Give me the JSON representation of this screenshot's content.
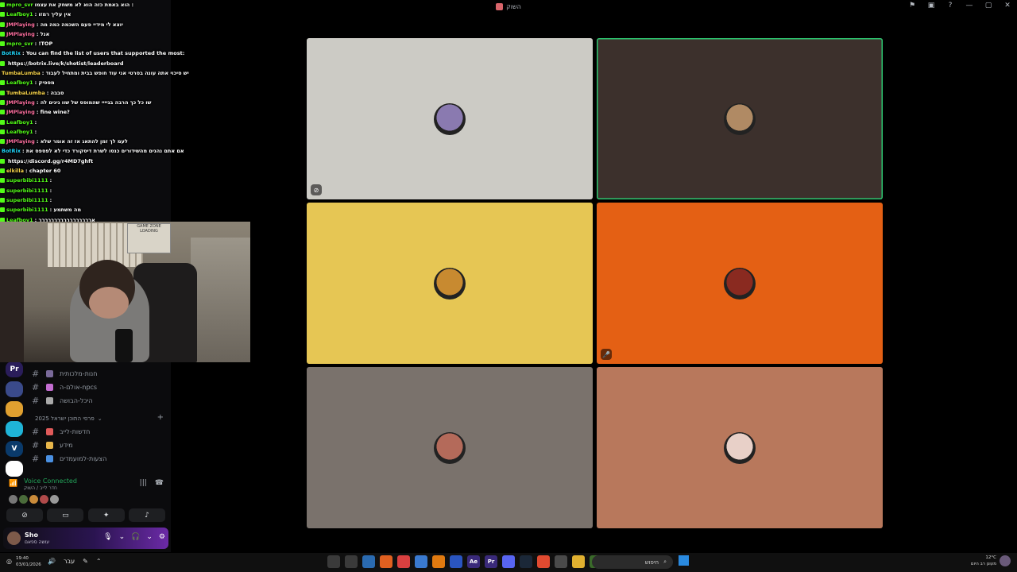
{
  "window": {
    "title": "השוק",
    "controls": [
      "⚑",
      "▣",
      "?",
      "—",
      "▢",
      "✕"
    ]
  },
  "chat": [
    {
      "name": "mpro_svr",
      "text": "הוא באמת כזה הוא לא משחק את עצמו :",
      "color": "green"
    },
    {
      "name": "Leafboy1",
      "text": ": אין עליך רמזו",
      "color": "green"
    },
    {
      "name": "JMPlaying",
      "text": ": יוצא לי מידיי פעם השכמה כמה מה",
      "color": "pink"
    },
    {
      "name": "JMPlaying",
      "text": ": אנל",
      "color": "pink"
    },
    {
      "name": "mpro_svr",
      "text": ": !TOP",
      "color": "green"
    },
    {
      "name": "BotRix",
      "text": ": You can find the list of users that supported the most:",
      "color": "bot"
    },
    {
      "name": "",
      "text": "https://botrix.live/k/shotist/leaderboard",
      "color": "bot"
    },
    {
      "name": "TumbaLumba",
      "text": ": יש סיכוי אתה עונה בסרטי אני עוד חופש בבית ומתחיל לעבוד",
      "color": "yellow"
    },
    {
      "name": "Leafboy1",
      "text": ": מספיק",
      "color": "green"
    },
    {
      "name": "TumbaLumba",
      "text": ": סבבה",
      "color": "yellow"
    },
    {
      "name": "JMPlaying",
      "text": ": שו כל כך הרבה בגיייי שהמופס של שוו גיגים לה",
      "color": "pink"
    },
    {
      "name": "JMPlaying",
      "text": ": fine wine?",
      "color": "pink"
    },
    {
      "name": "Leafboy1",
      "text": ":",
      "color": "green"
    },
    {
      "name": "Leafboy1",
      "text": ":",
      "color": "green"
    },
    {
      "name": "JMPlaying",
      "text": ": לעמ לך זמן להתאג אז זה אומר שלא",
      "color": "pink"
    },
    {
      "name": "BotRix",
      "text": ": אם אתם נהנים מהשידורים כנסו לשרת דיסקורד כדי לא לפספס את",
      "color": "bot"
    },
    {
      "name": "",
      "text": "https://discord.gg/r4MD7ghft",
      "color": "bot"
    },
    {
      "name": "elkilla",
      "text": ": chapter 60",
      "color": "yellow"
    },
    {
      "name": "superbibi1111",
      "text": ":",
      "color": "green"
    },
    {
      "name": "superbibi1111",
      "text": ":",
      "color": "green"
    },
    {
      "name": "superbibi1111",
      "text": ":",
      "color": "green"
    },
    {
      "name": "superbibi1111",
      "text": ": מה משתמע",
      "color": "green"
    },
    {
      "name": "Leafboy1",
      "text": ": אררררררררררררררררר",
      "color": "green"
    }
  ],
  "webcam": {
    "poster_text": "GAME ZONE",
    "poster_sub": "LOADING"
  },
  "channels": [
    {
      "label": "חנות-מלכותית",
      "color": "#7a6a9a"
    },
    {
      "label": "אולם-ה-npcs",
      "color": "#c46dd1"
    },
    {
      "label": "היכל-הבושה",
      "color": "#aaaaaa"
    }
  ],
  "category": {
    "label": "פרסי התוכן ישראל 2025"
  },
  "category_channels": [
    {
      "label": "חדשות-לייב",
      "color": "#e05a5a"
    },
    {
      "label": "מידע",
      "color": "#e8b64a"
    },
    {
      "label": "הצעות-למועמדים",
      "color": "#4a90e2"
    }
  ],
  "voice": {
    "status": "Voice Connected",
    "sub": "חדר לייב / השוק",
    "avatar_colors": [
      "#777777",
      "#4a6b3a",
      "#c98b3a",
      "#b04a4a",
      "#999999"
    ]
  },
  "user": {
    "name": "Sho",
    "status": "עושה ספאם"
  },
  "servers": [
    {
      "label": "Pr",
      "color": "#2a1d5a"
    },
    {
      "label": "",
      "color": "#3a4a8a"
    },
    {
      "label": "",
      "color": "#e0a030"
    },
    {
      "label": "",
      "color": "#1fb4d8"
    },
    {
      "label": "V",
      "color": "#0a3a6a"
    },
    {
      "label": "",
      "color": "#ffffff"
    }
  ],
  "tiles": [
    {
      "bg": "#cccbc5",
      "avatar": "#8a7ab0",
      "speaking": false,
      "icon": "screen-share-off-icon"
    },
    {
      "bg": "#3c302c",
      "avatar": "#b08a64",
      "speaking": true,
      "icon": ""
    },
    {
      "bg": "#e6c654",
      "avatar": "#c88a30",
      "speaking": false,
      "icon": ""
    },
    {
      "bg": "#e46014",
      "avatar": "#8a2a20",
      "speaking": false,
      "icon": "mic-muted-icon"
    },
    {
      "bg": "#7a726c",
      "avatar": "#b46a5a",
      "speaking": false,
      "icon": ""
    },
    {
      "bg": "#b8785c",
      "avatar": "#e8d0c8",
      "speaking": false,
      "icon": ""
    }
  ],
  "taskbar": {
    "time": "19:40",
    "date": "03/01/2026",
    "lang": "עבר",
    "search_placeholder": "חיפוש",
    "weather_temp": "12°C",
    "weather_desc": "מעונן רב היום",
    "apps": [
      {
        "label": "",
        "color": "#3a3a3a"
      },
      {
        "label": "",
        "color": "#3a3a3a"
      },
      {
        "label": "",
        "color": "#2a6ab0"
      },
      {
        "label": "",
        "color": "#e06020"
      },
      {
        "label": "",
        "color": "#d94040"
      },
      {
        "label": "",
        "color": "#3a7ad0"
      },
      {
        "label": "",
        "color": "#e07a10"
      },
      {
        "label": "",
        "color": "#2a55c0"
      },
      {
        "label": "Ae",
        "color": "#3a2a7a"
      },
      {
        "label": "Pr",
        "color": "#3a2a7a"
      },
      {
        "label": "",
        "color": "#5865f2"
      },
      {
        "label": "",
        "color": "#1b2838"
      },
      {
        "label": "",
        "color": "#e04a30"
      },
      {
        "label": "",
        "color": "#4a4a4a"
      },
      {
        "label": "",
        "color": "#e0b030"
      },
      {
        "label": "",
        "color": "#3a6a2a"
      }
    ]
  }
}
